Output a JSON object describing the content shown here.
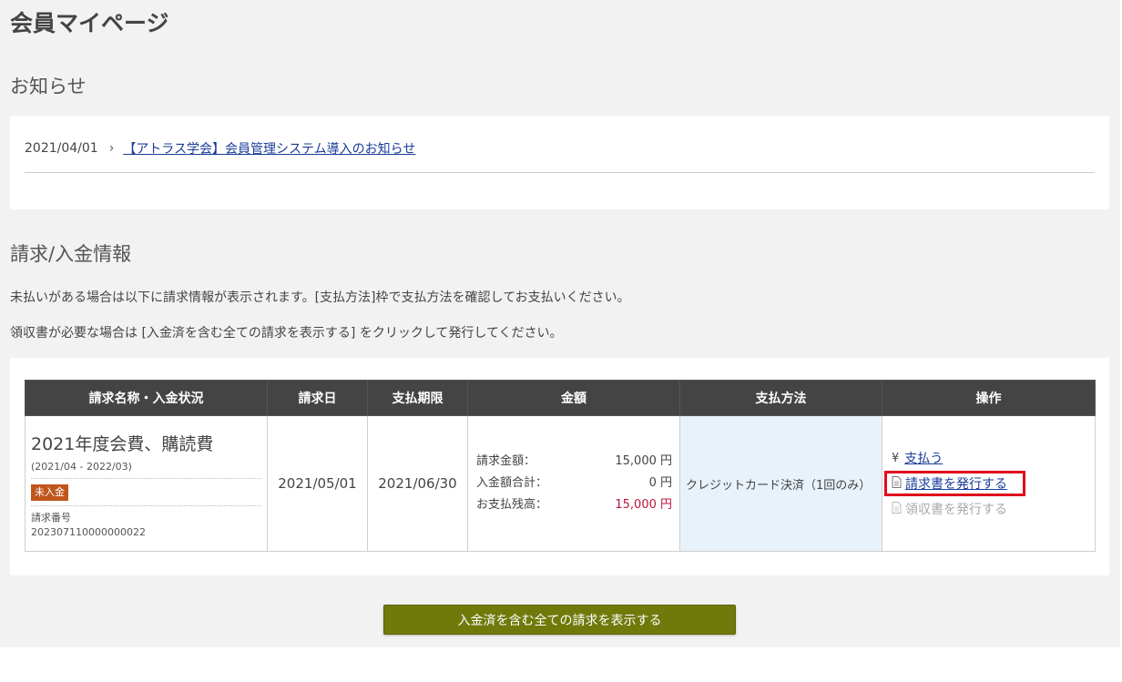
{
  "page": {
    "title": "会員マイページ"
  },
  "notice": {
    "section_title": "お知らせ",
    "items": [
      {
        "date": "2021/04/01",
        "arrow": "›",
        "title": "【アトラス学会】会員管理システム導入のお知らせ"
      }
    ]
  },
  "billing": {
    "section_title": "請求/入金情報",
    "description1": "未払いがある場合は以下に請求情報が表示されます。[支払方法]枠で支払方法を確認してお支払いください。",
    "description2": "領収書が必要な場合は [入金済を含む全ての請求を表示する] をクリックして発行してください。",
    "columns": [
      "請求名称・入金状況",
      "請求日",
      "支払期限",
      "金額",
      "支払方法",
      "操作"
    ],
    "rows": [
      {
        "name": "2021年度会費、購読費",
        "period": "(2021/04 - 2022/03)",
        "status": "未入金",
        "invoice_label": "請求番号",
        "invoice_number": "202307110000000022",
        "invoice_date": "2021/05/01",
        "due_date": "2021/06/30",
        "amount_label": "請求金額：",
        "amount_value": "15,000 円",
        "paid_label": "入金額合計：",
        "paid_value": "0 円",
        "balance_label": "お支払残高：",
        "balance_value": "15,000 円",
        "payment_method": "クレジットカード決済（1回のみ）",
        "ops": {
          "pay_icon": "¥",
          "pay_label": "支払う",
          "issue_invoice_label": "請求書を発行する",
          "issue_receipt_label": "領収書を発行する"
        }
      }
    ],
    "show_all_label": "入金済を含む全ての請求を表示する"
  },
  "icons": {
    "yen": "yen-icon",
    "document": "document-icon"
  },
  "colors": {
    "background": "#f2f2f2",
    "table_header": "#444444",
    "status_badge": "#c0561d",
    "balance_text": "#c0143c",
    "payment_method_bg": "#e8f2fb",
    "link": "#1a3c9a",
    "highlight_border": "#e00b1b",
    "show_all_button": "#6f7a0b"
  }
}
